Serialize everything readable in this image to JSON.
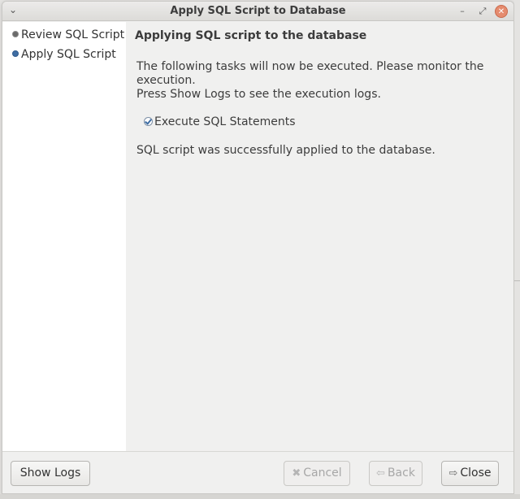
{
  "window": {
    "title": "Apply SQL Script to Database",
    "menu_icon": "chevron-down-icon",
    "controls": [
      "minimize-icon",
      "maximize-icon",
      "close-icon"
    ]
  },
  "sidebar": {
    "items": [
      {
        "label": "Review SQL Script",
        "state": "done"
      },
      {
        "label": "Apply SQL Script",
        "state": "current"
      }
    ]
  },
  "main": {
    "heading": "Applying SQL script to the database",
    "description_line1": "The following tasks will now be executed. Please monitor the execution.",
    "description_line2": "Press Show Logs to see the execution logs.",
    "task_label": "Execute SQL Statements",
    "task_done": true,
    "result": "SQL script was successfully applied to the database."
  },
  "footer": {
    "show_logs": "Show Logs",
    "cancel": "Cancel",
    "back": "Back",
    "close": "Close"
  },
  "colors": {
    "accent": "#3f6da3",
    "sidebar_bg": "#ffffff",
    "panel_bg": "#f0f0ef",
    "close_button": "#e58b6e"
  }
}
